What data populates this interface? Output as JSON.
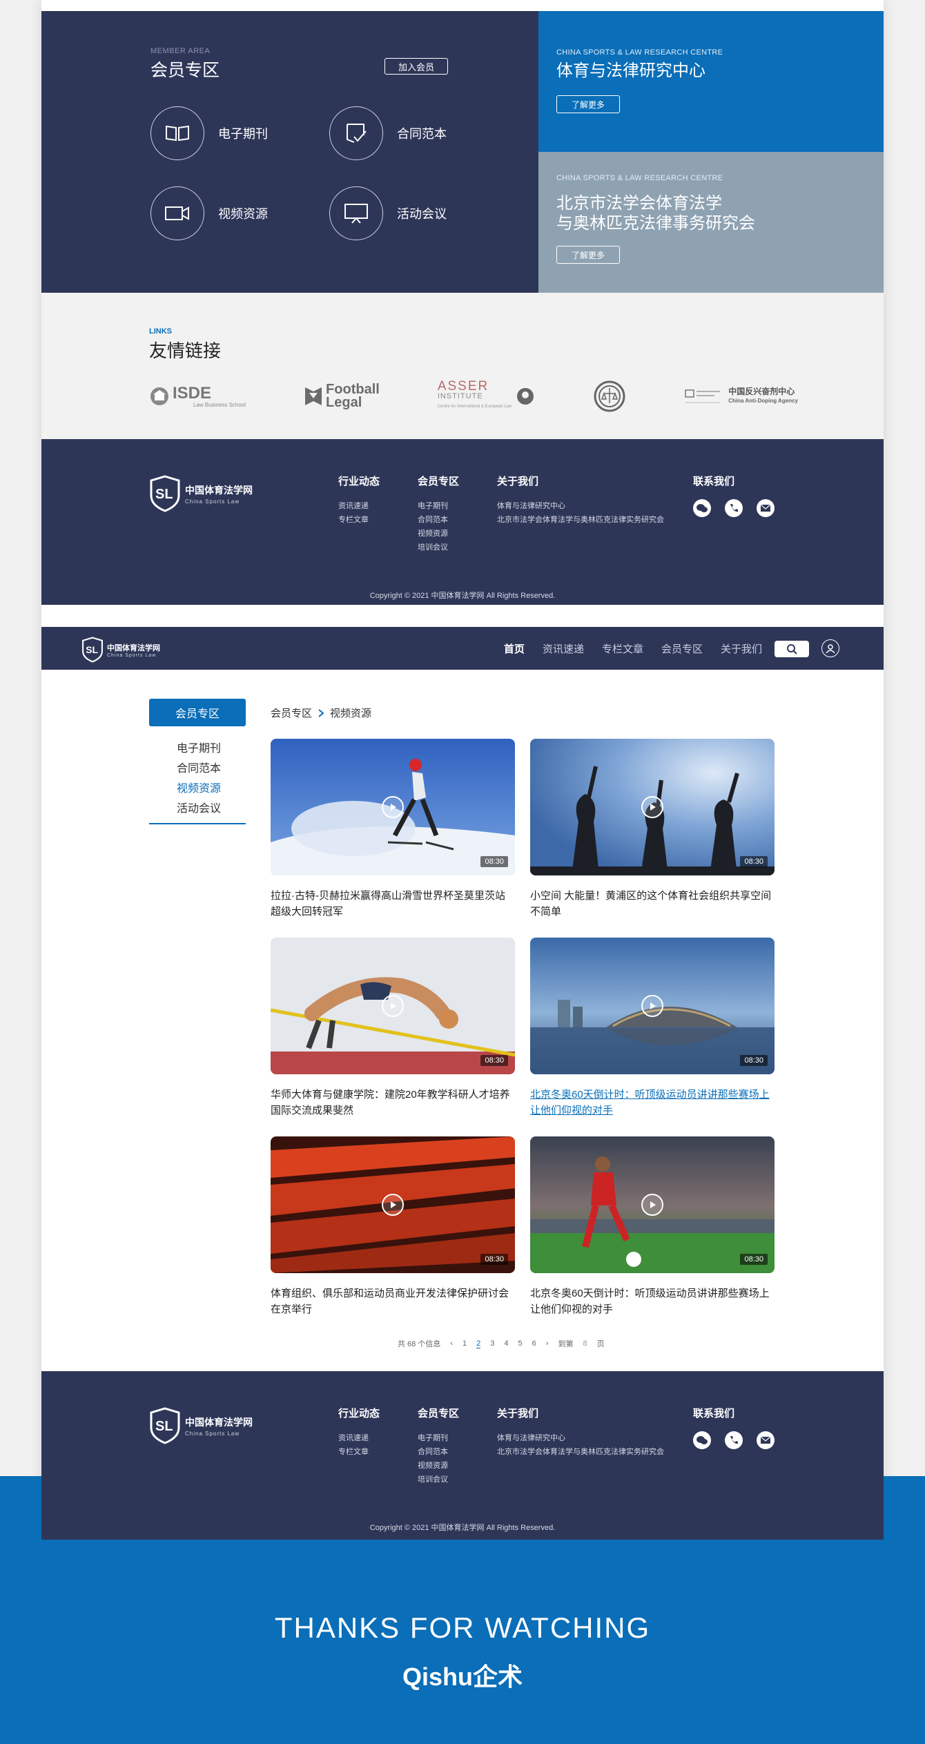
{
  "member": {
    "sub": "MEMBER AREA",
    "title": "会员专区",
    "join_label": "加入会员",
    "items": [
      {
        "label": "电子期刊",
        "icon": "book-icon"
      },
      {
        "label": "合同范本",
        "icon": "contract-icon"
      },
      {
        "label": "视频资源",
        "icon": "video-icon"
      },
      {
        "label": "活动会议",
        "icon": "presentation-icon"
      }
    ]
  },
  "research": [
    {
      "sub": "CHINA SPORTS & LAW RESEARCH CENTRE",
      "title": "体育与法律研究中心",
      "more": "了解更多"
    },
    {
      "sub": "CHINA SPORTS & LAW RESEARCH CENTRE",
      "title_line1": "北京市法学会体育法学",
      "title_line2": "与奥林匹克法律事务研究会",
      "more": "了解更多"
    }
  ],
  "links": {
    "sub": "LINKS",
    "title": "友情链接",
    "logos": {
      "isde_main": "ISDE",
      "isde_sub": "Law Business School",
      "football_1": "Football",
      "football_2": "Legal",
      "asser_main": "ASSER",
      "asser_2": "INSTITUTE",
      "asser_sub": "Centre for International & European Law",
      "chinada_cn": "中国反兴奋剂中心",
      "chinada_en": "China Anti-Doping Agency"
    }
  },
  "footer": {
    "logo_cn": "中国体育法学网",
    "logo_en": "China Sports Law",
    "cols": [
      {
        "title": "行业动态",
        "items": [
          "资讯速递",
          "专栏文章"
        ]
      },
      {
        "title": "会员专区",
        "items": [
          "电子期刊",
          "合同范本",
          "视频资源",
          "培训会议"
        ]
      },
      {
        "title": "关于我们",
        "items": [
          "体育与法律研究中心",
          "北京市法学会体育法学与奥林匹克法律实务研究会"
        ]
      }
    ],
    "contact_title": "联系我们",
    "copyright": "Copyright © 2021 中国体育法学网    All Rights Reserved."
  },
  "nav": {
    "logo_cn": "中国体育法学网",
    "logo_en": "China Sports Law",
    "links": [
      "首页",
      "资讯速递",
      "专栏文章",
      "会员专区",
      "关于我们"
    ]
  },
  "sidebar": {
    "head": "会员专区",
    "items": [
      "电子期刊",
      "合同范本",
      "视频资源",
      "活动会议"
    ]
  },
  "breadcrumb": {
    "parent": "会员专区",
    "current": "视频资源"
  },
  "videos": [
    {
      "title": "拉拉·古特-贝赫拉米赢得高山滑雪世界杯圣莫里茨站超级大回转冠军",
      "duration": "08:30"
    },
    {
      "title": "小空间 大能量！黄浦区的这个体育社会组织共享空间不简单",
      "duration": "08:30"
    },
    {
      "title": "华师大体育与健康学院：建院20年教学科研人才培养国际交流成果斐然",
      "duration": "08:30"
    },
    {
      "title": "北京冬奥60天倒计时：听顶级运动员讲讲那些赛场上让他们仰视的对手",
      "duration": "08:30"
    },
    {
      "title": "体育组织、俱乐部和运动员商业开发法律保护研讨会在京举行",
      "duration": "08:30"
    },
    {
      "title": "北京冬奥60天倒计时：听顶级运动员讲讲那些赛场上让他们仰视的对手",
      "duration": "08:30"
    }
  ],
  "pager": {
    "total": "共 68 个信息",
    "prev": "‹",
    "pages": [
      "1",
      "2",
      "3",
      "4",
      "5",
      "6"
    ],
    "next": "›",
    "goto": "到第",
    "goto_value": "8",
    "page_unit": "页"
  },
  "footer2_copyright": "Copyright © 2021 中国体育法学网    All Rights Reserved.",
  "thanks": {
    "title": "THANKS FOR WATCHING",
    "brand": "Qishu企术"
  }
}
